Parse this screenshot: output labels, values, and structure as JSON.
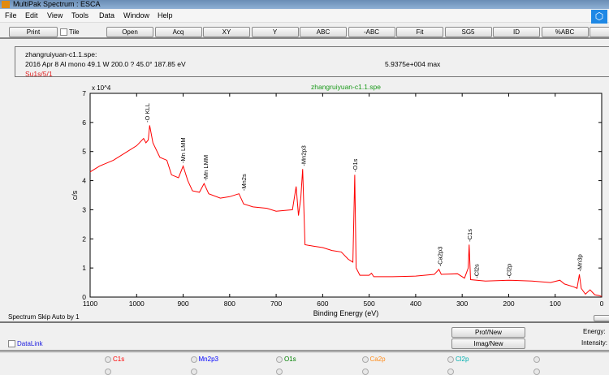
{
  "window": {
    "title": "MultiPak Spectrum : ESCA"
  },
  "menu": [
    "File",
    "Edit",
    "View",
    "Tools",
    "Data",
    "Window",
    "Help"
  ],
  "toolbar": {
    "print": "Print",
    "tile": "Tile",
    "buttons": [
      "Open",
      "Acq",
      "XY",
      "Y",
      "ABC",
      "-ABC",
      "Fit",
      "SG5",
      "ID",
      "%ABC"
    ]
  },
  "info": {
    "file": "zhangruiyuan-c1.1.spe:",
    "params": "2016 Apr 8  Al mono  49.1 W  200.0 ?  45.0°  187.85 eV",
    "region": "Su1s/5/1",
    "max": "5.9375e+004 max"
  },
  "status": {
    "skip": "Spectrum Skip Auto by 1",
    "datalink": "DataLink",
    "energy": "Energy:",
    "intensity": "Intensity:",
    "prof_new": "Prof/New",
    "imag_new": "Imag/New"
  },
  "elements": [
    {
      "label": "C1s",
      "color": "#ff0000"
    },
    {
      "label": "Mn2p3",
      "color": "#0000ff"
    },
    {
      "label": "O1s",
      "color": "#008000"
    },
    {
      "label": "Ca2p",
      "color": "#ff8c1a"
    },
    {
      "label": "Cl2p",
      "color": "#00b0b0"
    }
  ],
  "chart_data": {
    "type": "line",
    "title": "zhangruiyuan-c1.1.spe",
    "title_color": "#1a9a1a",
    "xlabel": "Binding Energy (eV)",
    "ylabel": "c/s",
    "y_multiplier": "x 10^4",
    "xlim": [
      1100,
      0
    ],
    "ylim": [
      0,
      7
    ],
    "x_reversed": true,
    "xticks": [
      1100,
      1000,
      900,
      800,
      700,
      600,
      500,
      400,
      300,
      200,
      100,
      0
    ],
    "yticks": [
      0,
      1,
      2,
      3,
      4,
      5,
      6,
      7
    ],
    "line_color": "#ff0000",
    "series": [
      {
        "x": [
          1100,
          1080,
          1050,
          1020,
          1000,
          985,
          980,
          975,
          972,
          965,
          950,
          935,
          925,
          910,
          900,
          890,
          880,
          865,
          855,
          845,
          820,
          800,
          780,
          770,
          750,
          720,
          700,
          665,
          657,
          652,
          647,
          643,
          638,
          620,
          600,
          580,
          560,
          545,
          535,
          531,
          528,
          520,
          500,
          495,
          490,
          450,
          400,
          360,
          350,
          345,
          310,
          295,
          287,
          285,
          282,
          250,
          200,
          150,
          110,
          90,
          80,
          60,
          53,
          48,
          44,
          35,
          25,
          15,
          5,
          0
        ],
        "y": [
          4.3,
          4.5,
          4.7,
          5.0,
          5.2,
          5.45,
          5.3,
          5.4,
          5.9,
          5.3,
          4.8,
          4.7,
          4.2,
          4.1,
          4.5,
          4.0,
          3.65,
          3.6,
          3.9,
          3.55,
          3.4,
          3.45,
          3.55,
          3.2,
          3.1,
          3.05,
          2.95,
          3.0,
          3.8,
          2.8,
          3.4,
          4.4,
          1.8,
          1.75,
          1.7,
          1.6,
          1.55,
          1.3,
          1.2,
          4.2,
          1.0,
          0.75,
          0.75,
          0.82,
          0.7,
          0.7,
          0.72,
          0.78,
          0.95,
          0.78,
          0.8,
          0.65,
          1.0,
          1.8,
          0.6,
          0.55,
          0.58,
          0.55,
          0.5,
          0.58,
          0.45,
          0.35,
          0.3,
          0.78,
          0.3,
          0.1,
          0.25,
          0.08,
          0.05,
          0.02
        ]
      }
    ],
    "annotations": [
      {
        "label": "O KLL",
        "x": 978,
        "y": 6.0
      },
      {
        "label": "Mn LMM",
        "x": 901,
        "y": 4.6
      },
      {
        "label": "Mn LMM",
        "x": 852,
        "y": 4.0
      },
      {
        "label": "Mn2s",
        "x": 770,
        "y": 3.65
      },
      {
        "label": "Mn2p3",
        "x": 642,
        "y": 4.5
      },
      {
        "label": "O1s",
        "x": 531,
        "y": 4.3
      },
      {
        "label": "Ca2p3",
        "x": 348,
        "y": 1.05
      },
      {
        "label": "C1s",
        "x": 285,
        "y": 1.9
      },
      {
        "label": "Cl2s",
        "x": 270,
        "y": 0.65
      },
      {
        "label": "Cl2p",
        "x": 200,
        "y": 0.65
      },
      {
        "label": "Mn3p",
        "x": 48,
        "y": 0.88
      }
    ]
  }
}
